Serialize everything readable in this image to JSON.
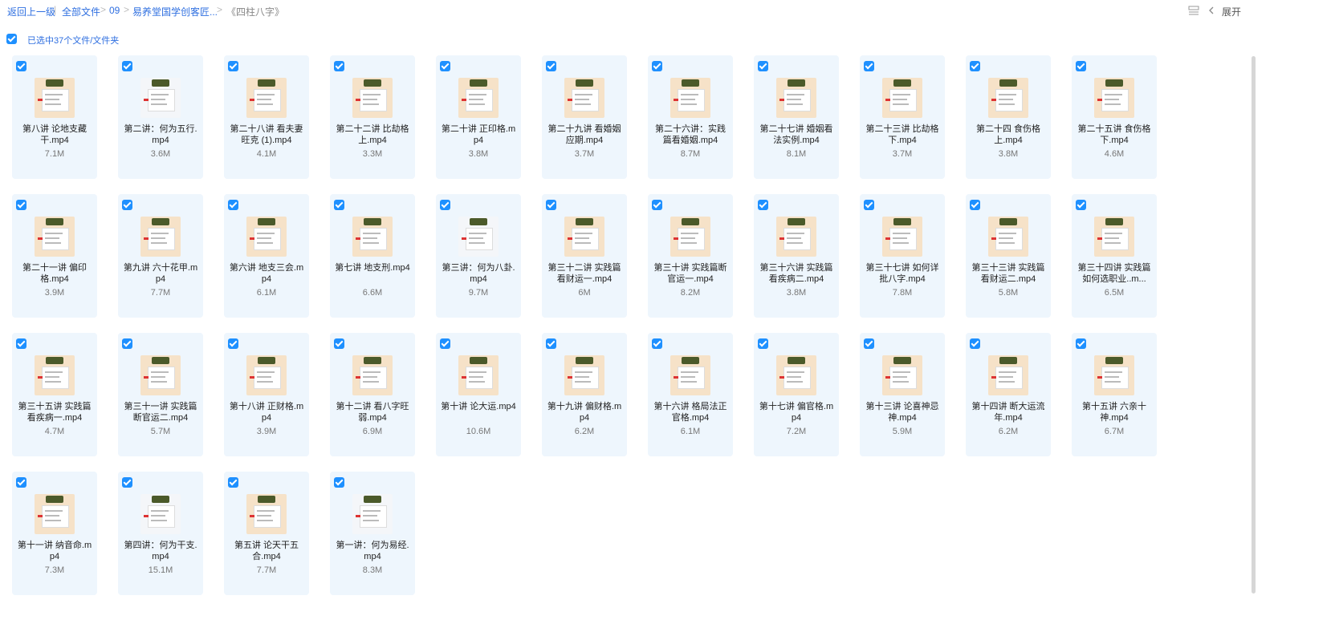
{
  "breadcrumb": {
    "back": "返回上一级",
    "items": [
      "全部文件",
      "09",
      "易养堂国学创客匠...",
      "《四柱八字》"
    ]
  },
  "toolbar": {
    "expand": "展开"
  },
  "selection": {
    "label": "已选中37个文件/文件夹"
  },
  "files": [
    {
      "name": "第八讲 论地支藏干.mp4",
      "size": "7.1M"
    },
    {
      "name": "第二讲：何为五行.mp4",
      "size": "3.6M"
    },
    {
      "name": "第二十八讲 看夫妻旺克 (1).mp4",
      "size": "4.1M"
    },
    {
      "name": "第二十二讲 比劫格上.mp4",
      "size": "3.3M"
    },
    {
      "name": "第二十讲 正印格.mp4",
      "size": "3.8M"
    },
    {
      "name": "第二十九讲 看婚姻应期.mp4",
      "size": "3.7M"
    },
    {
      "name": "第二十六讲：实践篇看婚姻.mp4",
      "size": "8.7M"
    },
    {
      "name": "第二十七讲 婚姻看法实例.mp4",
      "size": "8.1M"
    },
    {
      "name": "第二十三讲 比劫格下.mp4",
      "size": "3.7M"
    },
    {
      "name": "第二十四 食伤格上.mp4",
      "size": "3.8M"
    },
    {
      "name": "第二十五讲 食伤格下.mp4",
      "size": "4.6M"
    },
    {
      "name": "第二十一讲 偏印格.mp4",
      "size": "3.9M"
    },
    {
      "name": "第九讲 六十花甲.mp4",
      "size": "7.7M"
    },
    {
      "name": "第六讲 地支三会.mp4",
      "size": "6.1M"
    },
    {
      "name": "第七讲 地支刑.mp4",
      "size": "6.6M"
    },
    {
      "name": "第三讲：何为八卦.mp4",
      "size": "9.7M"
    },
    {
      "name": "第三十二讲 实践篇看财运一.mp4",
      "size": "6M"
    },
    {
      "name": "第三十讲 实践篇断官运一.mp4",
      "size": "8.2M"
    },
    {
      "name": "第三十六讲 实践篇看疾病二.mp4",
      "size": "3.8M"
    },
    {
      "name": "第三十七讲 如何详批八字.mp4",
      "size": "7.8M"
    },
    {
      "name": "第三十三讲 实践篇看财运二.mp4",
      "size": "5.8M"
    },
    {
      "name": "第三十四讲 实践篇如何选职业..m...",
      "size": "6.5M"
    },
    {
      "name": "第三十五讲 实践篇看疾病一.mp4",
      "size": "4.7M"
    },
    {
      "name": "第三十一讲 实践篇断官运二.mp4",
      "size": "5.7M"
    },
    {
      "name": "第十八讲 正财格.mp4",
      "size": "3.9M"
    },
    {
      "name": "第十二讲 看八字旺弱.mp4",
      "size": "6.9M"
    },
    {
      "name": "第十讲 论大运.mp4",
      "size": "10.6M"
    },
    {
      "name": "第十九讲 偏财格.mp4",
      "size": "6.2M"
    },
    {
      "name": "第十六讲 格局法正官格.mp4",
      "size": "6.1M"
    },
    {
      "name": "第十七讲 偏官格.mp4",
      "size": "7.2M"
    },
    {
      "name": "第十三讲 论喜神忌神.mp4",
      "size": "5.9M"
    },
    {
      "name": "第十四讲 断大运流年.mp4",
      "size": "6.2M"
    },
    {
      "name": "第十五讲 六亲十神.mp4",
      "size": "6.7M"
    },
    {
      "name": "第十一讲 纳音命.mp4",
      "size": "7.3M"
    },
    {
      "name": "第四讲：何为干支.mp4",
      "size": "15.1M"
    },
    {
      "name": "第五讲 论天干五合.mp4",
      "size": "7.7M"
    },
    {
      "name": "第一讲：何为易经.mp4",
      "size": "8.3M"
    }
  ],
  "colors": {
    "accent": "#1e90ff",
    "card_bg": "#eef6fd",
    "link": "#2f6fe0"
  }
}
